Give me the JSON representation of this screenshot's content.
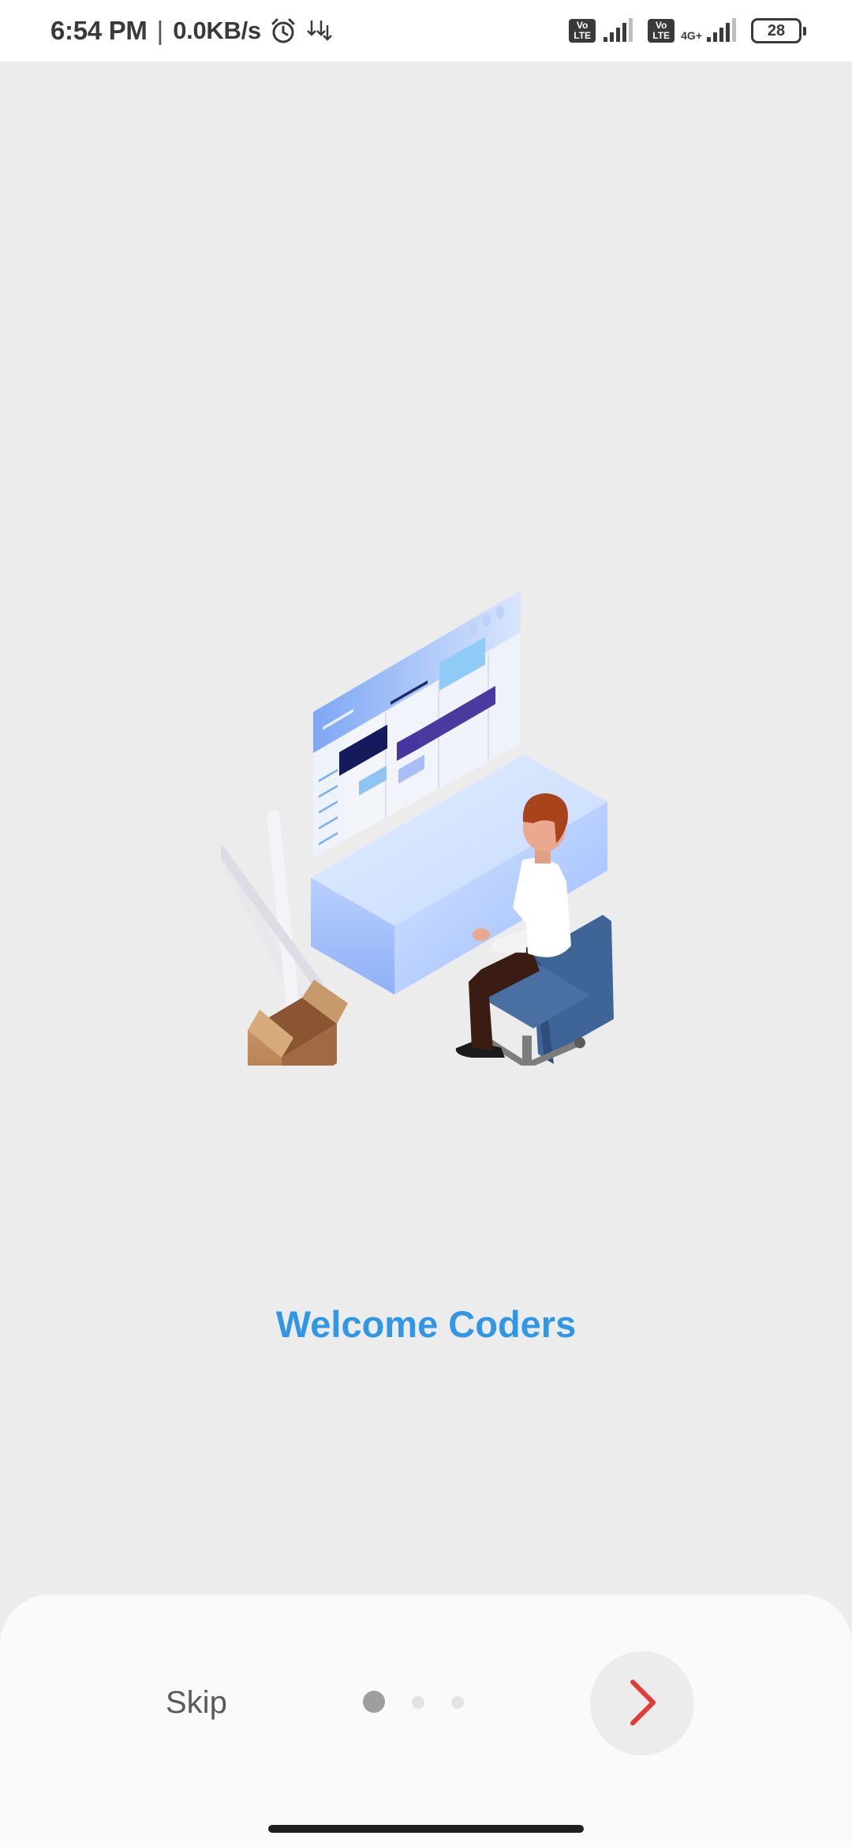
{
  "status_bar": {
    "time": "6:54 PM",
    "separator": "|",
    "speed": "0.0KB/s",
    "sim1_badge_line1": "Vo",
    "sim1_badge_line2": "LTE",
    "sim2_badge_line1": "Vo",
    "sim2_badge_line2": "LTE",
    "network_type": "4G+",
    "battery": "28",
    "icons": [
      "alarm-icon",
      "download-icon",
      "signal-icon",
      "battery-icon"
    ]
  },
  "onboarding": {
    "title": "Welcome Coders",
    "illustration": "developer-at-desk-illustration",
    "current_page": 1,
    "total_pages": 3
  },
  "footer": {
    "skip_label": "Skip",
    "next_icon": "chevron-right-icon"
  },
  "colors": {
    "background": "#ececec",
    "title": "#2f97e6",
    "next_arrow": "#e53935",
    "active_dot": "#9e9e9e",
    "inactive_dot": "#e3e3e3"
  }
}
